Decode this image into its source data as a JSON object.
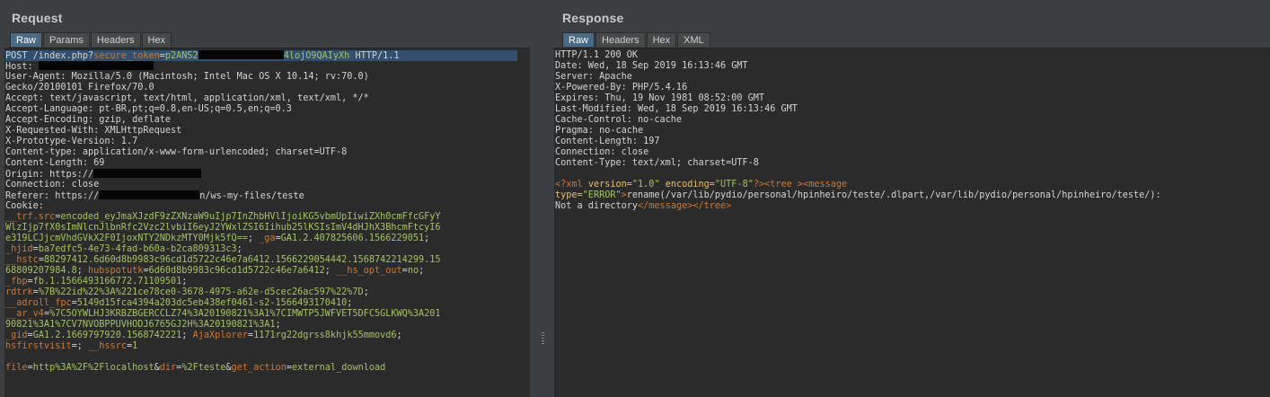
{
  "request": {
    "title": "Request",
    "tabs": [
      "Raw",
      "Params",
      "Headers",
      "Hex"
    ],
    "lines": [
      [
        [
          "k",
          "POST /index.php?"
        ],
        [
          "o",
          "secure_token"
        ],
        [
          "k",
          "="
        ],
        [
          "g",
          "p2ANS2"
        ],
        [
          "r",
          "95"
        ],
        [
          "g",
          "4lojO9QAIyXh"
        ],
        [
          "k",
          " HTTP/1.1"
        ]
      ],
      [
        [
          "k",
          "Host: "
        ],
        [
          "r",
          "128"
        ]
      ],
      [
        [
          "k",
          "User-Agent: Mozilla/5.0 (Macintosh; Intel Mac OS X 10.14; rv:70.0)"
        ]
      ],
      [
        [
          "k",
          "Gecko/20100101 Firefox/70.0"
        ]
      ],
      [
        [
          "k",
          "Accept: text/javascript, text/html, application/xml, text/xml, */*"
        ]
      ],
      [
        [
          "k",
          "Accept-Language: pt-BR,pt;q=0.8,en-US;q=0.5,en;q=0.3"
        ]
      ],
      [
        [
          "k",
          "Accept-Encoding: gzip, deflate"
        ]
      ],
      [
        [
          "k",
          "X-Requested-With: XMLHttpRequest"
        ]
      ],
      [
        [
          "k",
          "X-Prototype-Version: 1.7"
        ]
      ],
      [
        [
          "k",
          "Content-type: application/x-www-form-urlencoded; charset=UTF-8"
        ]
      ],
      [
        [
          "k",
          "Content-Length: 69"
        ]
      ],
      [
        [
          "k",
          "Origin: https://"
        ],
        [
          "r",
          "120"
        ]
      ],
      [
        [
          "k",
          "Connection: close"
        ]
      ],
      [
        [
          "k",
          "Referer: https://"
        ],
        [
          "r",
          "112"
        ],
        [
          "k",
          "n/ws-my-files/teste"
        ]
      ],
      [
        [
          "k",
          "Cookie:"
        ]
      ],
      [
        [
          "o",
          "__trf.src"
        ],
        [
          "k",
          "="
        ],
        [
          "g",
          "encoded_eyJmaXJzdF9zZXNzaW9uIjp7InZhbHVlIjoiKG5vbmUpIiwiZXh0cmFfcGFyY"
        ]
      ],
      [
        [
          "g",
          "WlzIjp7fX0sImNlcnJlbnRfc2Vzc2lvbiI6eyJ2YWxlZSI6Iihub25lKSIsImV4dHJhX3BhcmFtcyI6"
        ]
      ],
      [
        [
          "g",
          "e319LCJjcmVhdGVkX2F0IjoxNTY2NDkzMTY0Mjk5fQ=="
        ],
        [
          "k",
          "; "
        ],
        [
          "o",
          "_ga"
        ],
        [
          "k",
          "="
        ],
        [
          "g",
          "GA1.2.407825606.1566229051"
        ],
        [
          "k",
          ";"
        ]
      ],
      [
        [
          "o",
          "_hjid"
        ],
        [
          "k",
          "="
        ],
        [
          "g",
          "ba7edfc5-4e73-4fad-b60a-b2ca809313c3"
        ],
        [
          "k",
          ";"
        ]
      ],
      [
        [
          "o",
          "__hstc"
        ],
        [
          "k",
          "="
        ],
        [
          "g",
          "88297412.6d60d8b9983c96cd1d5722c46e7a6412.1566229054442.1568742214299.15"
        ]
      ],
      [
        [
          "g",
          "68809207984.8"
        ],
        [
          "k",
          "; "
        ],
        [
          "o",
          "hubspotutk"
        ],
        [
          "k",
          "="
        ],
        [
          "g",
          "6d60d8b9983c96cd1d5722c46e7a6412"
        ],
        [
          "k",
          "; "
        ],
        [
          "o",
          "__hs_opt_out"
        ],
        [
          "k",
          "="
        ],
        [
          "g",
          "no"
        ],
        [
          "k",
          ";"
        ]
      ],
      [
        [
          "o",
          "_fbp"
        ],
        [
          "k",
          "="
        ],
        [
          "g",
          "fb.1.1566493166772.71109501"
        ],
        [
          "k",
          ";"
        ]
      ],
      [
        [
          "o",
          "rdtrk"
        ],
        [
          "k",
          "="
        ],
        [
          "g",
          "%7B%22id%22%3A%221ce78ce0-3678-4975-a62e-d5cec26ac597%22%7D"
        ],
        [
          "k",
          ";"
        ]
      ],
      [
        [
          "o",
          "__adroll_fpc"
        ],
        [
          "k",
          "="
        ],
        [
          "g",
          "5149d15fca4394a203dc5eb438ef0461-s2-1566493170410"
        ],
        [
          "k",
          ";"
        ]
      ],
      [
        [
          "o",
          "__ar_v4"
        ],
        [
          "k",
          "="
        ],
        [
          "g",
          "%7C5OYWLHJ3KRBZBGERCCLZ74%3A20190821%3A1%7CIMWTP5JWFVET5DFC5GLKWQ%3A201"
        ]
      ],
      [
        [
          "g",
          "90821%3A1%7CV7NVOBPPUVHODJ6765GJ2H%3A20190821%3A1"
        ],
        [
          "k",
          ";"
        ]
      ],
      [
        [
          "o",
          "_gid"
        ],
        [
          "k",
          "="
        ],
        [
          "g",
          "GA1.2.1669797920.1568742221"
        ],
        [
          "k",
          "; "
        ],
        [
          "o",
          "AjaXplorer"
        ],
        [
          "k",
          "="
        ],
        [
          "g",
          "1171rg22dgrss8khjk55mmovd6"
        ],
        [
          "k",
          ";"
        ]
      ],
      [
        [
          "o",
          "hsfirstvisit"
        ],
        [
          "k",
          "=; "
        ],
        [
          "o",
          "__hssrc"
        ],
        [
          "k",
          "="
        ],
        [
          "g",
          "1"
        ]
      ],
      [
        [
          "k",
          ""
        ]
      ],
      [
        [
          "o",
          "file"
        ],
        [
          "k",
          "="
        ],
        [
          "g",
          "http%3A%2F%2Flocalhost"
        ],
        [
          "k",
          "&"
        ],
        [
          "o",
          "dir"
        ],
        [
          "k",
          "="
        ],
        [
          "g",
          "%2Fteste"
        ],
        [
          "k",
          "&"
        ],
        [
          "o",
          "get_action"
        ],
        [
          "k",
          "="
        ],
        [
          "g",
          "external_download"
        ]
      ]
    ]
  },
  "response": {
    "title": "Response",
    "tabs": [
      "Raw",
      "Headers",
      "Hex",
      "XML"
    ],
    "lines": [
      [
        [
          "k",
          "HTTP/1.1 200 OK"
        ]
      ],
      [
        [
          "k",
          "Date: Wed, 18 Sep 2019 16:13:46 GMT"
        ]
      ],
      [
        [
          "k",
          "Server: Apache"
        ]
      ],
      [
        [
          "k",
          "X-Powered-By: PHP/5.4.16"
        ]
      ],
      [
        [
          "k",
          "Expires: Thu, 19 Nov 1981 08:52:00 GMT"
        ]
      ],
      [
        [
          "k",
          "Last-Modified: Wed, 18 Sep 2019 16:13:46 GMT"
        ]
      ],
      [
        [
          "k",
          "Cache-Control: no-cache"
        ]
      ],
      [
        [
          "k",
          "Pragma: no-cache"
        ]
      ],
      [
        [
          "k",
          "Content-Length: 197"
        ]
      ],
      [
        [
          "k",
          "Connection: close"
        ]
      ],
      [
        [
          "k",
          "Content-Type: text/xml; charset=UTF-8"
        ]
      ],
      [
        [
          "k",
          ""
        ]
      ],
      [
        [
          "o",
          "<?xml "
        ],
        [
          "y",
          "version="
        ],
        [
          "g",
          "\"1.0\""
        ],
        [
          "y",
          " encoding="
        ],
        [
          "g",
          "\"UTF-8\""
        ],
        [
          "o",
          "?>"
        ],
        [
          "o",
          "<tree >"
        ],
        [
          "o",
          "<message"
        ]
      ],
      [
        [
          "y",
          "type="
        ],
        [
          "g",
          "\"ERROR\""
        ],
        [
          "o",
          ">"
        ],
        [
          "k",
          "rename(/var/lib/pydio/personal/hpinheiro/teste/.dlpart,/var/lib/pydio/personal/hpinheiro/teste/):"
        ]
      ],
      [
        [
          "k",
          "Not a directory"
        ],
        [
          "o",
          "</message>"
        ],
        [
          "o",
          "</tree>"
        ]
      ]
    ]
  },
  "colors": {
    "background": "#3c3f41",
    "editor": "#2b2b2b",
    "text": "#d4d4d4",
    "name": "#cc7832",
    "value": "#a5c261",
    "active_tab": "#4b6a86",
    "highlight": "#32506e"
  }
}
